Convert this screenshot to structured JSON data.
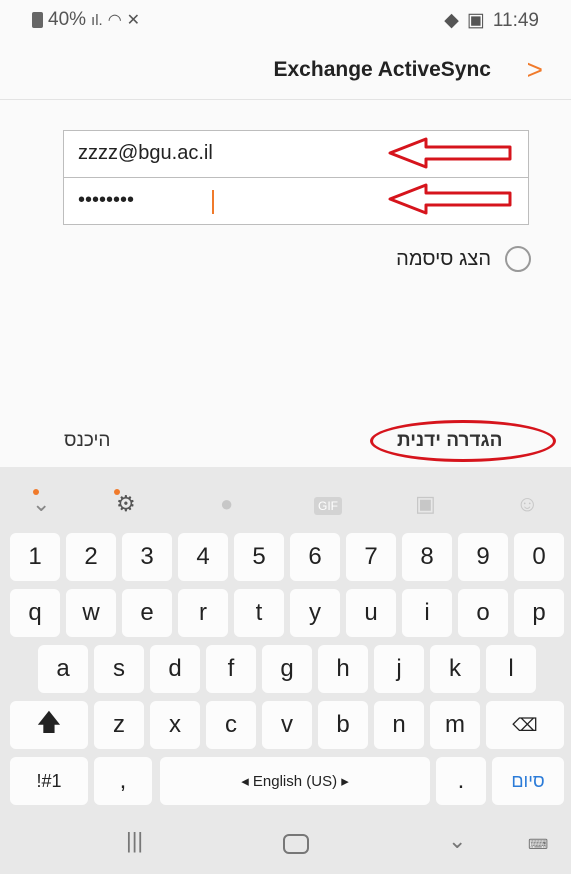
{
  "status": {
    "battery": "40%",
    "time": "11:49"
  },
  "header": {
    "title": "Exchange ActiveSync",
    "forward_glyph": ">"
  },
  "form": {
    "email_value": "zzzz@bgu.ac.il",
    "password_value": "••••••••",
    "show_password_label": "הצג סיסמה"
  },
  "actions": {
    "manual_setup": "הגדרה ידנית",
    "sign_in": "היכנס"
  },
  "keyboard": {
    "row_numbers": [
      "1",
      "2",
      "3",
      "4",
      "5",
      "6",
      "7",
      "8",
      "9",
      "0"
    ],
    "row_top": [
      "q",
      "w",
      "e",
      "r",
      "t",
      "y",
      "u",
      "i",
      "o",
      "p"
    ],
    "row_mid": [
      "a",
      "s",
      "d",
      "f",
      "g",
      "h",
      "j",
      "k",
      "l"
    ],
    "row_bottom": [
      "z",
      "x",
      "c",
      "v",
      "b",
      "n",
      "m"
    ],
    "symbols_label": "!#1",
    "comma_label": ",",
    "space_label": "◂ English (US) ▸",
    "period_label": ".",
    "done_label": "סיום"
  },
  "colors": {
    "accent": "#f07a2b",
    "annotation_red": "#d6141c"
  }
}
